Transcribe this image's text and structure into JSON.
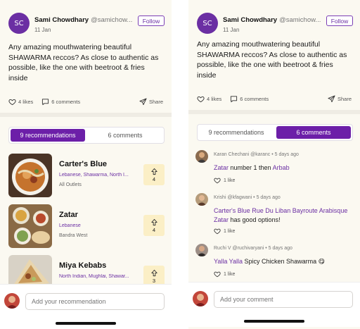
{
  "post": {
    "author_name": "Sami Chowdhary",
    "author_handle": "@samichow...",
    "avatar_initials": "SC",
    "date": "11 Jan",
    "follow_label": "Follow",
    "body": "Any amazing mouthwatering beautiful SHAWARMA reccos? As close to authentic as possible, like the one with beetroot & fries inside",
    "likes": "4 likes",
    "comments": "6 comments",
    "share": "Share"
  },
  "tabs": {
    "recommendations": "9 recommendations",
    "comments": "6 comments"
  },
  "recommendations": [
    {
      "name": "Carter's Blue",
      "tags": "Lebanese, Shawarma, North I...",
      "location": "All Outlets",
      "votes": "4"
    },
    {
      "name": "Zatar",
      "tags": "Lebanese",
      "location": "Bandra West",
      "votes": "4"
    },
    {
      "name": "Miya Kebabs",
      "tags": "North Indian, Mughlai, Shawar...",
      "location": "",
      "votes": "3"
    }
  ],
  "comments_list": [
    {
      "author": "Karan Chechani",
      "handle": "@karanc",
      "time": "5 days ago",
      "parts": [
        {
          "text": "Zatar",
          "link": true
        },
        {
          "text": " number 1 then ",
          "link": false
        },
        {
          "text": "Arbab",
          "link": true
        }
      ],
      "likes": "1 like"
    },
    {
      "author": "Krishi",
      "handle": "@kfagwani",
      "time": "5 days ago",
      "parts": [
        {
          "text": "Carter's Blue Rue Du Liban Bayroute Arabisque Zatar",
          "link": true
        },
        {
          "text": " has good options!",
          "link": false
        }
      ],
      "likes": "1 like"
    },
    {
      "author": "Ruchi V",
      "handle": "@ruchivaryani",
      "time": "5 days ago",
      "parts": [
        {
          "text": "Yalla Yalla",
          "link": true
        },
        {
          "text": " Spicy Chicken Shawarma 😋",
          "link": false
        }
      ],
      "likes": "1 like"
    }
  ],
  "inputs": {
    "recommendation_placeholder": "Add your recommendation",
    "comment_placeholder": "Add your comment"
  },
  "colors": {
    "accent": "#6c1fa8",
    "vote_bg": "#fbefc6",
    "screen_bg": "#fbf9f1"
  },
  "icons": {
    "like": "heart-icon",
    "comment": "speech-bubble-icon",
    "share": "paper-plane-icon",
    "upvote": "arrow-up-icon"
  }
}
